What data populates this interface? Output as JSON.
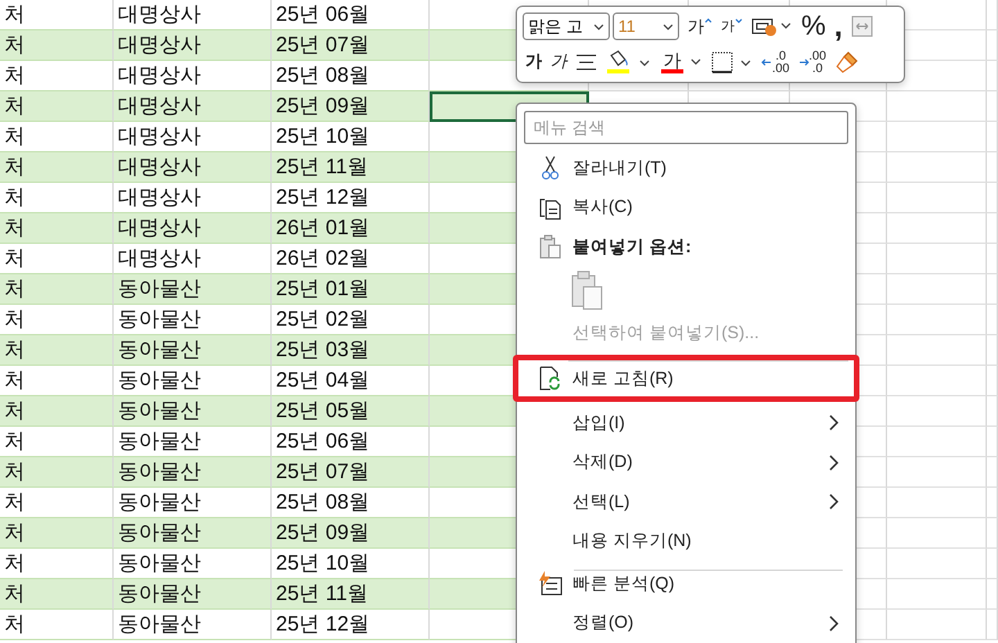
{
  "sheet": {
    "rows": [
      {
        "column_1": "처",
        "column_2": "대명상사",
        "column_3": "25년 06월",
        "selected": false
      },
      {
        "column_1": "처",
        "column_2": "대명상사",
        "column_3": "25년 07월",
        "selected": false
      },
      {
        "column_1": "처",
        "column_2": "대명상사",
        "column_3": "25년 08월",
        "selected": false
      },
      {
        "column_1": "처",
        "column_2": "대명상사",
        "column_3": "25년 09월",
        "selected": true
      },
      {
        "column_1": "처",
        "column_2": "대명상사",
        "column_3": "25년 10월",
        "selected": false
      },
      {
        "column_1": "처",
        "column_2": "대명상사",
        "column_3": "25년 11월",
        "selected": false
      },
      {
        "column_1": "처",
        "column_2": "대명상사",
        "column_3": "25년 12월",
        "selected": false
      },
      {
        "column_1": "처",
        "column_2": "대명상사",
        "column_3": "26년 01월",
        "selected": false
      },
      {
        "column_1": "처",
        "column_2": "대명상사",
        "column_3": "26년 02월",
        "selected": false
      },
      {
        "column_1": "처",
        "column_2": "동아물산",
        "column_3": "25년 01월",
        "selected": false
      },
      {
        "column_1": "처",
        "column_2": "동아물산",
        "column_3": "25년 02월",
        "selected": false
      },
      {
        "column_1": "처",
        "column_2": "동아물산",
        "column_3": "25년 03월",
        "selected": false
      },
      {
        "column_1": "처",
        "column_2": "동아물산",
        "column_3": "25년 04월",
        "selected": false
      },
      {
        "column_1": "처",
        "column_2": "동아물산",
        "column_3": "25년 05월",
        "selected": false
      },
      {
        "column_1": "처",
        "column_2": "동아물산",
        "column_3": "25년 06월",
        "selected": false
      },
      {
        "column_1": "처",
        "column_2": "동아물산",
        "column_3": "25년 07월",
        "selected": false
      },
      {
        "column_1": "처",
        "column_2": "동아물산",
        "column_3": "25년 08월",
        "selected": false
      },
      {
        "column_1": "처",
        "column_2": "동아물산",
        "column_3": "25년 09월",
        "selected": false
      },
      {
        "column_1": "처",
        "column_2": "동아물산",
        "column_3": "25년 10월",
        "selected": false
      },
      {
        "column_1": "처",
        "column_2": "동아물산",
        "column_3": "25년 11월",
        "selected": false
      },
      {
        "column_1": "처",
        "column_2": "동아물산",
        "column_3": "25년 12월",
        "selected": false
      }
    ]
  },
  "mini_toolbar": {
    "font": "맑은 고",
    "size": "11",
    "grow_label": "가",
    "shrink_label": "가",
    "percent": "%",
    "comma": ",",
    "bold_label": "가",
    "italic_label": "가",
    "font_color_label": "가",
    "increase_decimal": {
      "top": ".0",
      "bottom": ".00"
    },
    "decrease_decimal": {
      "top": ".00",
      "bottom": ".0"
    }
  },
  "context_menu": {
    "search_placeholder": "메뉴 검색",
    "items": [
      {
        "kind": "cut",
        "label": "잘라내기(T)",
        "submenu": false,
        "disabled": false,
        "highlighted": false,
        "separator_before": false
      },
      {
        "kind": "copy",
        "label": "복사(C)",
        "submenu": false,
        "disabled": false,
        "highlighted": false,
        "separator_before": false
      },
      {
        "kind": "paste_heading",
        "label": "붙여넣기 옵션:",
        "submenu": false,
        "disabled": false,
        "highlighted": false,
        "separator_before": false
      },
      {
        "kind": "paste_option",
        "submenu": false,
        "disabled": true,
        "highlighted": false,
        "separator_before": false
      },
      {
        "kind": "plain",
        "label": "선택하여 붙여넣기(S)...",
        "submenu": false,
        "disabled": true,
        "highlighted": false,
        "separator_before": false
      },
      {
        "kind": "refresh",
        "label": "새로 고침(R)",
        "submenu": false,
        "disabled": false,
        "highlighted": true,
        "separator_before": true
      },
      {
        "kind": "plain",
        "label": "삽입(I)",
        "submenu": true,
        "disabled": false,
        "highlighted": false,
        "separator_before": false
      },
      {
        "kind": "plain",
        "label": "삭제(D)",
        "submenu": true,
        "disabled": false,
        "highlighted": false,
        "separator_before": false
      },
      {
        "kind": "plain",
        "label": "선택(L)",
        "submenu": true,
        "disabled": false,
        "highlighted": false,
        "separator_before": false
      },
      {
        "kind": "plain",
        "label": "내용 지우기(N)",
        "submenu": false,
        "disabled": false,
        "highlighted": false,
        "separator_before": false
      },
      {
        "kind": "quick_analysis",
        "label": "빠른 분석(Q)",
        "submenu": false,
        "disabled": false,
        "highlighted": false,
        "separator_before": true
      },
      {
        "kind": "plain",
        "label": "정렬(O)",
        "submenu": true,
        "disabled": false,
        "highlighted": false,
        "separator_before": false
      }
    ]
  }
}
